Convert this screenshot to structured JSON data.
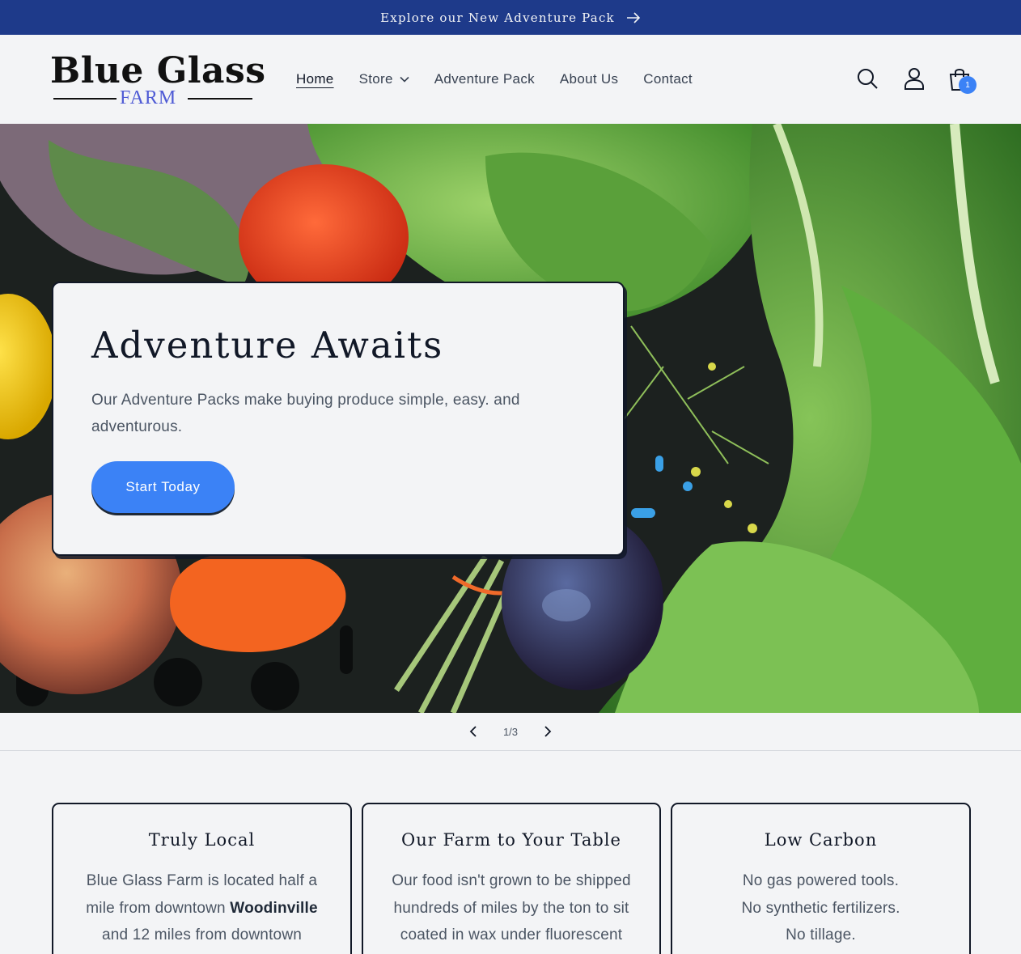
{
  "announcement": {
    "text": "Explore our New Adventure Pack"
  },
  "logo": {
    "main": "Blue Glass",
    "sub": "FARM"
  },
  "nav": {
    "home": "Home",
    "store": "Store",
    "adventure_pack": "Adventure Pack",
    "about": "About Us",
    "contact": "Contact"
  },
  "cart": {
    "count": "1"
  },
  "hero": {
    "title": "Adventure Awaits",
    "text": "Our Adventure Packs make buying produce simple, easy. and adventurous.",
    "button": "Start Today"
  },
  "slider": {
    "count": "1/3"
  },
  "features": [
    {
      "title": "Truly Local",
      "line1": "Blue Glass Farm is located half a",
      "line2a": "mile from downtown ",
      "line2b": "Woodinville",
      "line3": "and 12 miles from downtown"
    },
    {
      "title": "Our Farm to Your Table",
      "line1": "Our food isn't grown to be shipped",
      "line2": "hundreds of miles by the ton to sit",
      "line3": "coated in wax under fluorescent"
    },
    {
      "title": "Low Carbon",
      "line1": "No gas powered tools.",
      "line2": "No synthetic fertilizers.",
      "line3": "No tillage."
    }
  ],
  "colors": {
    "accent": "#3b82f6",
    "announcement_bg": "#1e3a8a",
    "page_bg": "#f3f4f6"
  }
}
